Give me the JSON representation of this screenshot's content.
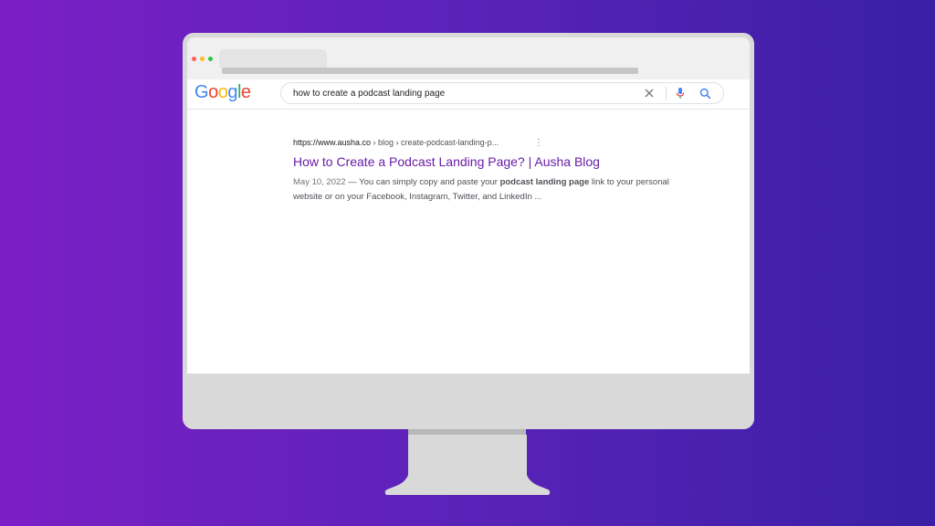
{
  "colors": {
    "background_left": "#7b1fc6",
    "background_right": "#3a1fa6",
    "traffic_red": "#ff5f57",
    "traffic_yellow": "#febc2e",
    "traffic_green": "#28c840",
    "link_visited": "#681da8"
  },
  "logo": {
    "letters": [
      "G",
      "o",
      "o",
      "g",
      "l",
      "e"
    ],
    "letter_colors": [
      "#4285f4",
      "#ea4335",
      "#fbbc05",
      "#4285f4",
      "#34a853",
      "#ea4335"
    ]
  },
  "search": {
    "query": "how to create a podcast landing page",
    "clear_icon": "close-icon",
    "mic_icon": "mic-icon",
    "search_icon": "search-icon"
  },
  "result": {
    "url_domain": "https://www.ausha.co",
    "url_path": " › blog › create-podcast-landing-p...",
    "menu_icon": "⋮",
    "title": "How to Create a Podcast Landing Page? | Ausha Blog",
    "date": "May 10, 2022",
    "snippet_before": " — You can simply copy and paste your ",
    "snippet_bold": "podcast landing page",
    "snippet_after": " link to your personal website or on your Facebook, Instagram, Twitter, and LinkedIn ..."
  }
}
